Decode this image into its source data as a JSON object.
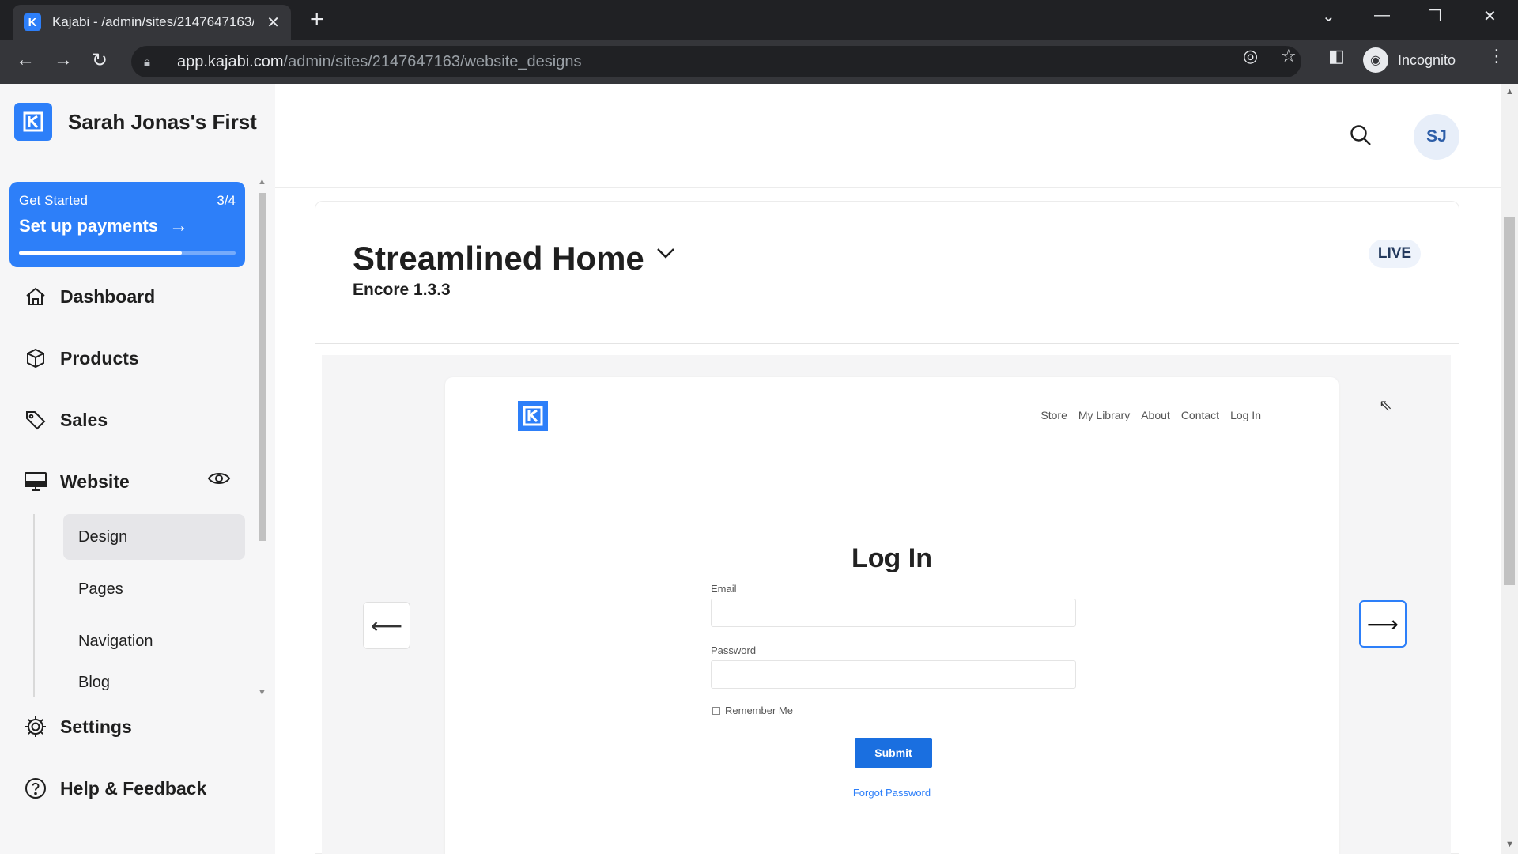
{
  "browser": {
    "tab_title": "Kajabi - /admin/sites/2147647163/",
    "favicon_letter": "K",
    "new_tab": "+",
    "url_host": "app.kajabi.com",
    "url_path": "/admin/sites/2147647163/website_designs",
    "profile_label": "Incognito"
  },
  "sidebar": {
    "site_name": "Sarah Jonas's First",
    "get_started": {
      "label": "Get Started",
      "step": "3/4",
      "action": "Set up payments",
      "progress_fraction": 0.75
    },
    "nav": {
      "dashboard": "Dashboard",
      "products": "Products",
      "sales": "Sales",
      "website": "Website",
      "settings": "Settings",
      "help": "Help & Feedback"
    },
    "website_subnav": {
      "design": "Design",
      "pages": "Pages",
      "navigation": "Navigation",
      "blog": "Blog"
    }
  },
  "header": {
    "avatar_initials": "SJ"
  },
  "theme": {
    "name": "Streamlined Home",
    "version": "Encore 1.3.3",
    "status": "LIVE"
  },
  "preview": {
    "nav_links": [
      "Store",
      "My Library",
      "About",
      "Contact",
      "Log In"
    ],
    "title": "Log In",
    "email_label": "Email",
    "password_label": "Password",
    "remember_label": "Remember Me",
    "submit_label": "Submit",
    "forgot_label": "Forgot Password"
  },
  "colors": {
    "brand": "#2d7ff9",
    "submit": "#1a6fe0",
    "sidebar_bg": "#f6f6f7"
  },
  "icons": [
    "kajabi-logo-icon",
    "search-icon",
    "home-icon",
    "box-icon",
    "tag-icon",
    "monitor-icon",
    "eye-icon",
    "gear-icon",
    "help-circle-icon",
    "chevron-down-icon",
    "arrow-left-icon",
    "arrow-right-icon"
  ]
}
